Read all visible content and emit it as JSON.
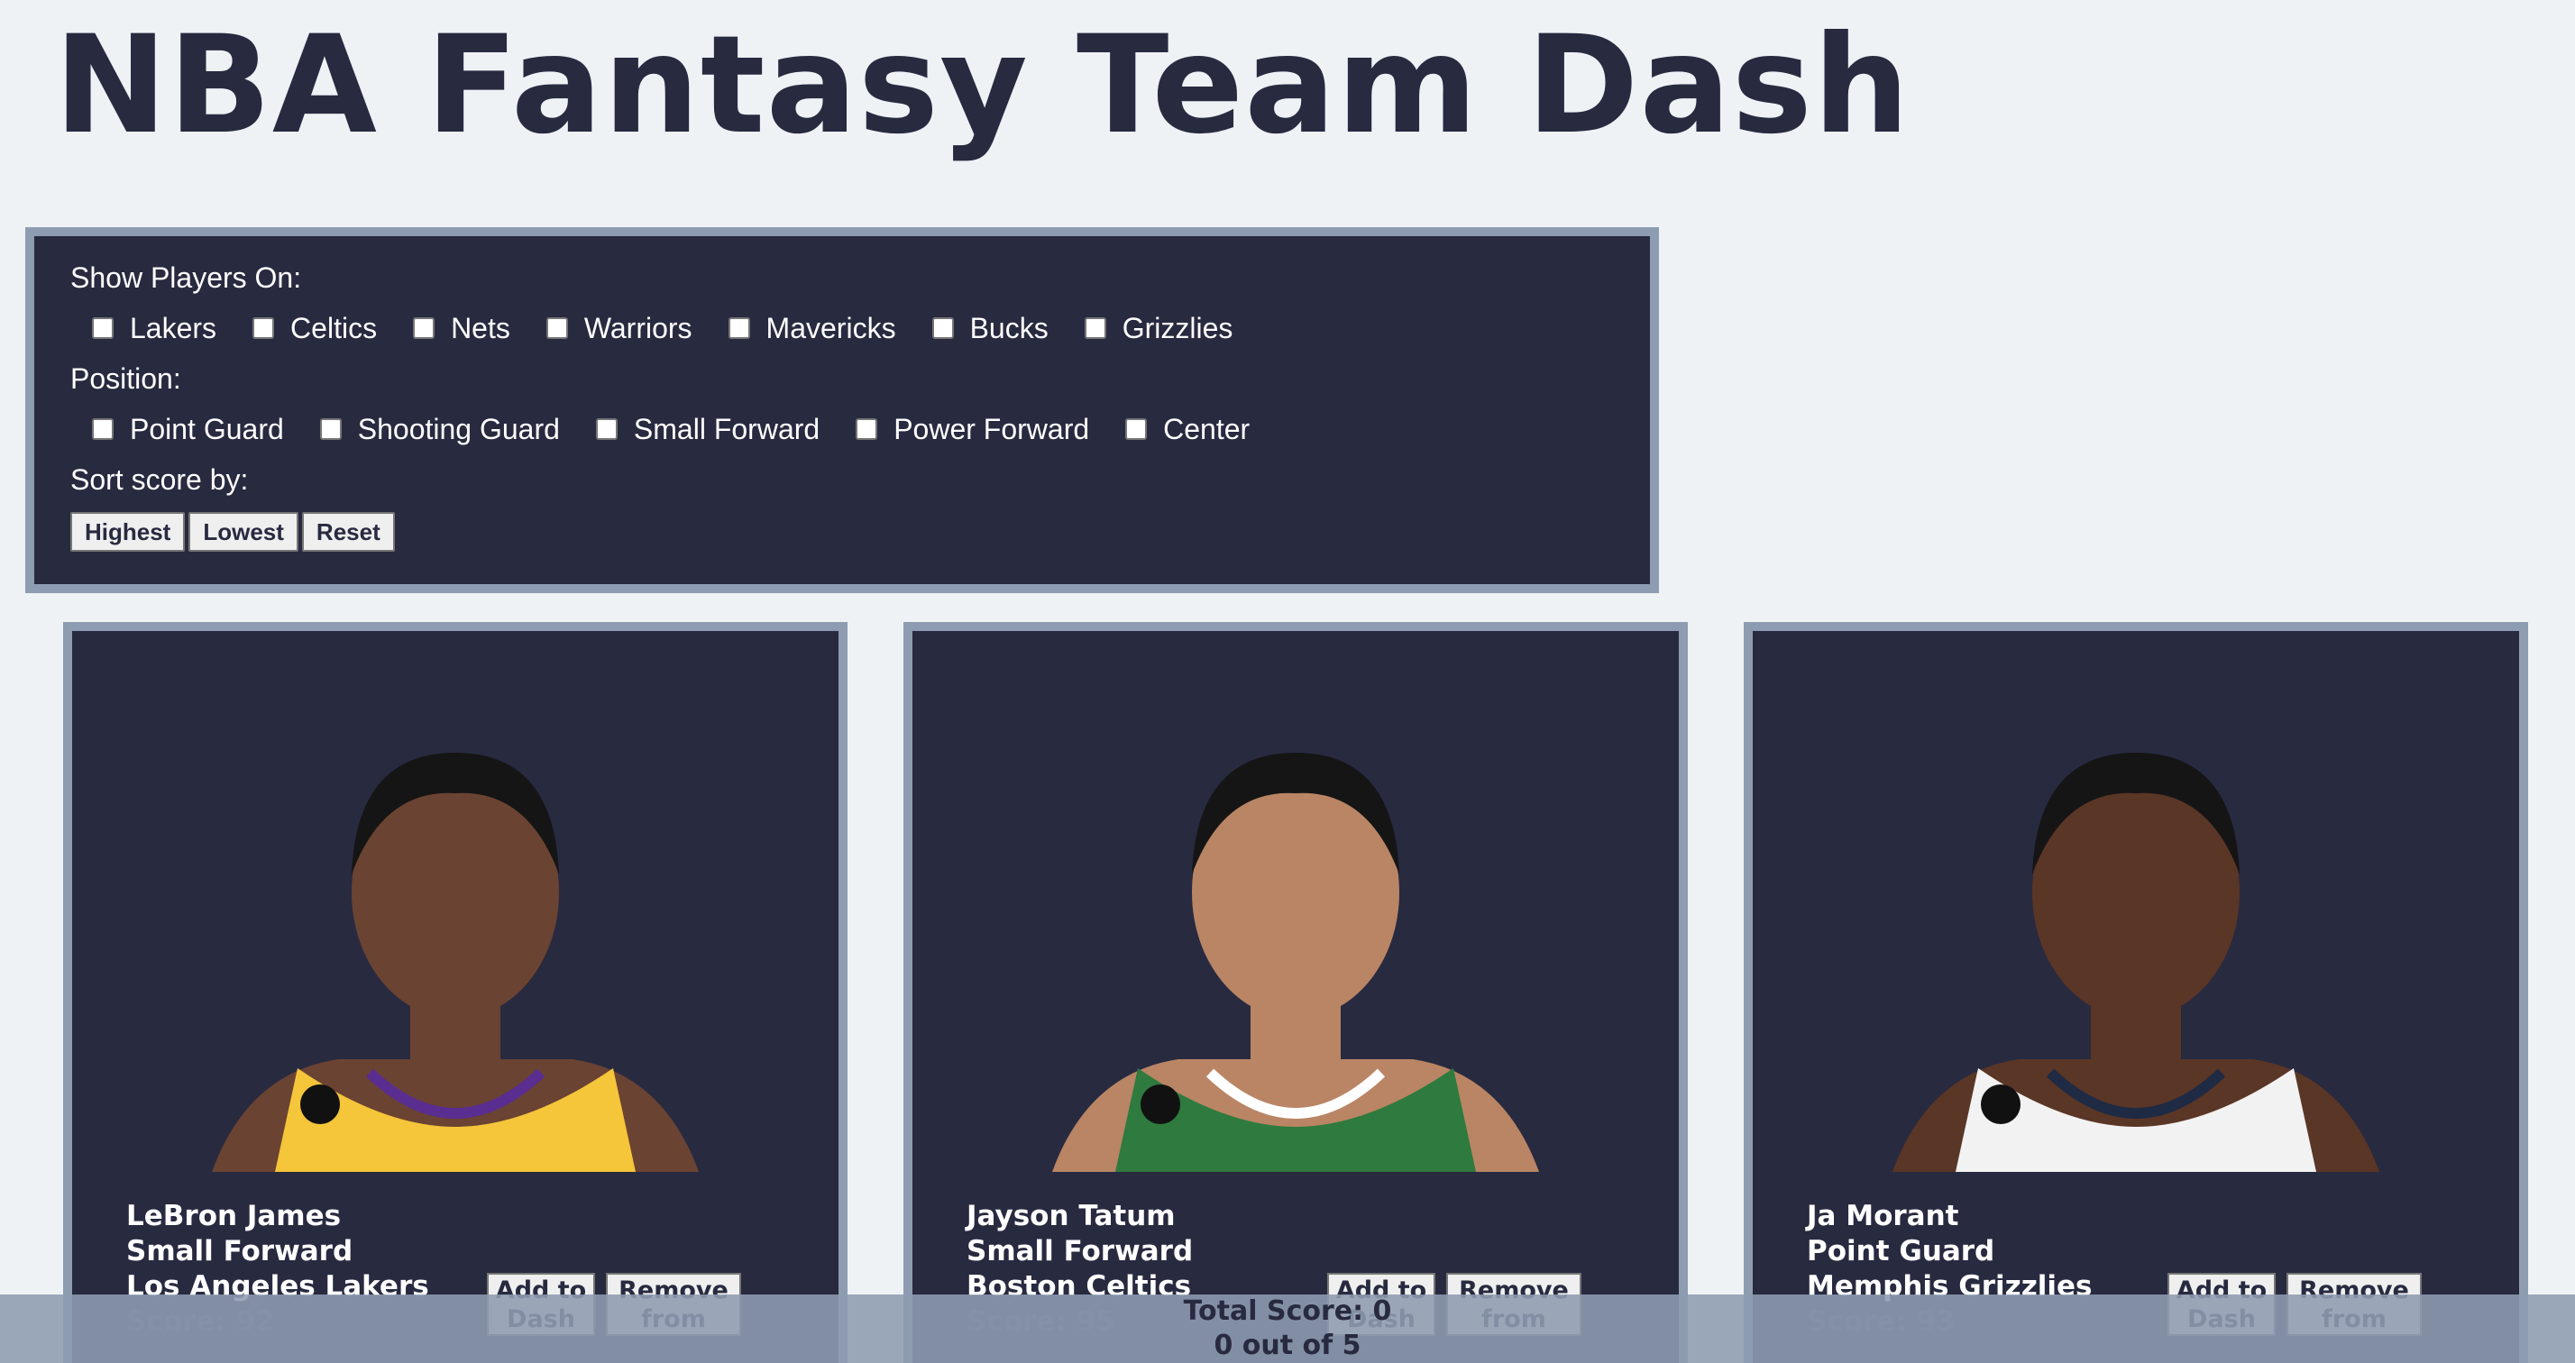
{
  "page": {
    "title": "NBA Fantasy Team Dash"
  },
  "filters": {
    "team_label": "Show Players On:",
    "teams": [
      "Lakers",
      "Celtics",
      "Nets",
      "Warriors",
      "Mavericks",
      "Bucks",
      "Grizzlies"
    ],
    "position_label": "Position:",
    "positions": [
      "Point Guard",
      "Shooting Guard",
      "Small Forward",
      "Power Forward",
      "Center"
    ],
    "sort_label": "Sort score by:",
    "sort_buttons": [
      "Highest",
      "Lowest",
      "Reset"
    ]
  },
  "players": [
    {
      "name": "LeBron James",
      "position": "Small Forward",
      "team": "Los Angeles Lakers",
      "score": "Score: 92",
      "jersey_color": "#f5c53a",
      "trim_color": "#5a2d91",
      "skin": "#6b4332",
      "add_label": "Add to Dash",
      "remove_label": "Remove from Dash"
    },
    {
      "name": "Jayson Tatum",
      "position": "Small Forward",
      "team": "Boston Celtics",
      "score": "Score: 95",
      "jersey_color": "#2f7a3e",
      "trim_color": "#ffffff",
      "skin": "#b98564",
      "add_label": "Add to Dash",
      "remove_label": "Remove from Dash"
    },
    {
      "name": "Ja Morant",
      "position": "Point Guard",
      "team": "Memphis Grizzlies",
      "score": "Score: 93",
      "jersey_color": "#f2f2f2",
      "trim_color": "#1f2a44",
      "skin": "#5a3626",
      "add_label": "Add to Dash",
      "remove_label": "Remove from Dash"
    }
  ],
  "footer": {
    "total": "Total Score: 0",
    "count": "0 out of 5"
  }
}
